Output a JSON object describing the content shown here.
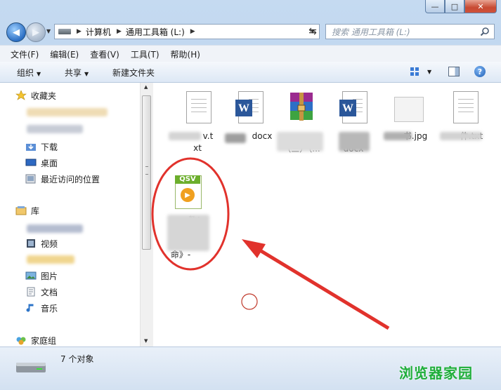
{
  "window": {
    "caption_min": "—",
    "caption_max": "□",
    "caption_close": "✕"
  },
  "nav": {
    "back_icon": "back-arrow-icon",
    "forward_icon": "forward-arrow-icon",
    "breadcrumb": [
      "计算机",
      "通用工具箱 (L:)"
    ],
    "search_placeholder": "搜索 通用工具箱 (L:)"
  },
  "menu": [
    "文件(F)",
    "编辑(E)",
    "查看(V)",
    "工具(T)",
    "帮助(H)"
  ],
  "toolbar": {
    "organize": "组织",
    "share": "共享",
    "new_folder": "新建文件夹"
  },
  "sidebar": {
    "favorites": "收藏夹",
    "downloads": "下载",
    "desktop": "桌面",
    "recent": "最近访问的位置",
    "libraries": "库",
    "videos": "视频",
    "pictures": "图片",
    "documents": "文档",
    "music": "音乐",
    "homegroup": "家庭组"
  },
  "files": [
    {
      "label1": "v.t",
      "label2": "xt",
      "type": "txt"
    },
    {
      "label1": "docx",
      "label2": "",
      "type": "word"
    },
    {
      "label1": "（三）（...",
      "label2": "",
      "type": "rar"
    },
    {
      "label1": "docx",
      "label2": "",
      "type": "word"
    },
    {
      "label1": "书.jpg",
      "label2": "",
      "type": "jpg"
    },
    {
      "label1": "件.txt",
      "label2": "",
      "type": "txt"
    },
    {
      "label1": "数！",
      "label2": "命》-",
      "type": "qsv",
      "badge": "QSV"
    }
  ],
  "status": {
    "count": "7 个对象"
  },
  "watermark": "浏览器家园",
  "colors": {
    "annotation": "#e1322c",
    "watermark": "#1fae3a"
  }
}
